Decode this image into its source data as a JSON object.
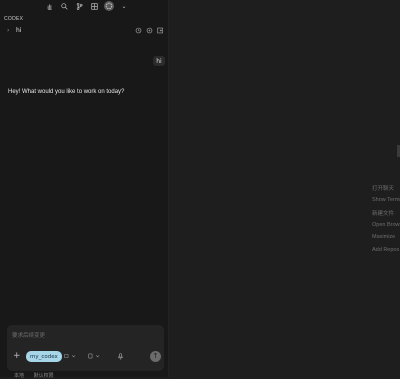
{
  "toolbar": {
    "icons": [
      "hand-icon",
      "search-icon",
      "source-control-icon",
      "extensions-icon",
      "codex-avatar-icon",
      "chevron-down-icon"
    ]
  },
  "panel": {
    "title": "CODEX"
  },
  "thread": {
    "title": "hi",
    "header_icons": [
      "history-icon",
      "settings-icon",
      "new-chat-icon"
    ]
  },
  "messages": {
    "user": "hi",
    "assistant": "Hey! What would you like to work on today?"
  },
  "composer": {
    "placeholder": "要求后续变更",
    "context_chip": "my_codex",
    "send_icon": "arrow-up-icon"
  },
  "footer": {
    "items": [
      "本地",
      "默认权限"
    ]
  },
  "editor_empty": {
    "commands": [
      "打开聊天",
      "Show Terminal",
      "新建文件",
      "Open Browser",
      "Maximize",
      "Add Repos"
    ]
  }
}
